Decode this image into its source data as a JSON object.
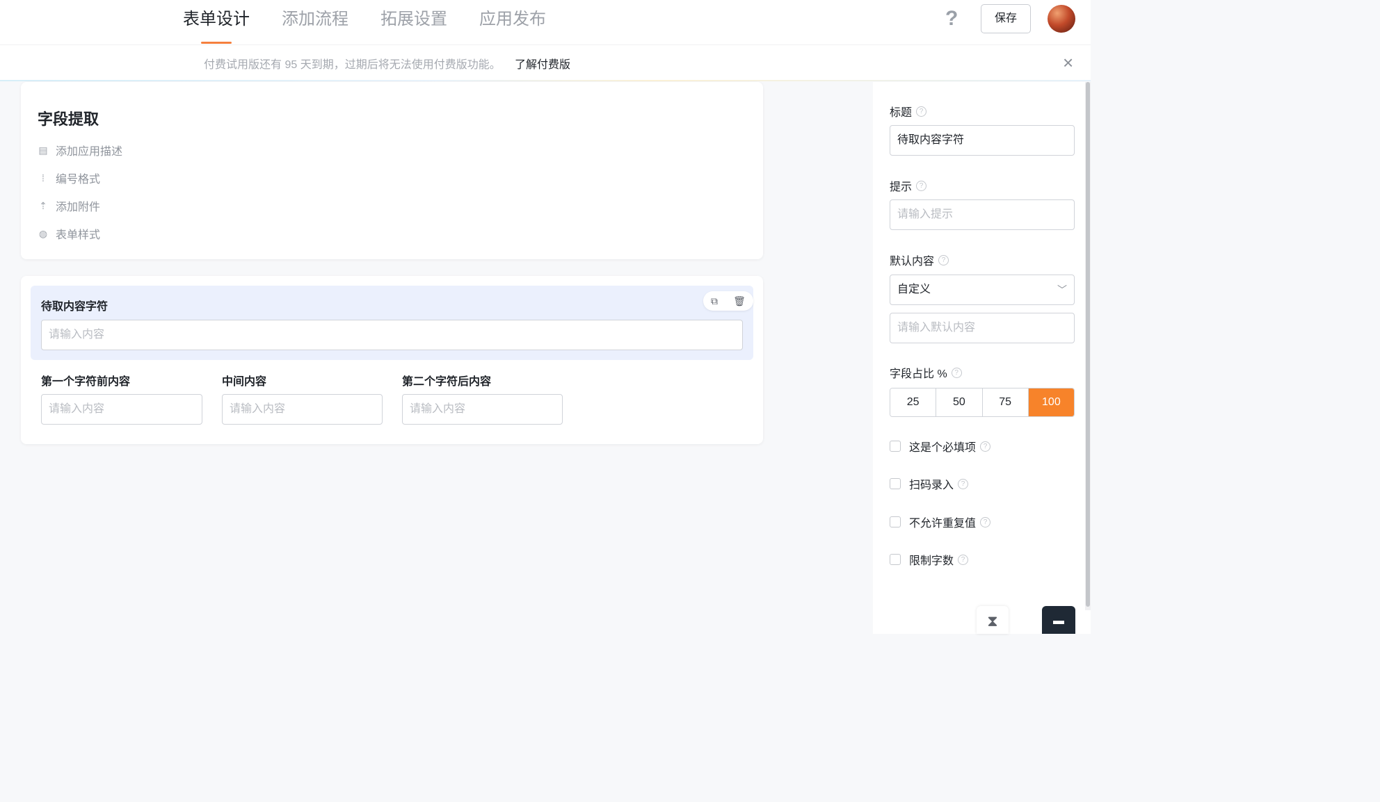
{
  "header": {
    "tabs": [
      {
        "label": "表单设计",
        "active": true
      },
      {
        "label": "添加流程",
        "active": false
      },
      {
        "label": "拓展设置",
        "active": false
      },
      {
        "label": "应用发布",
        "active": false
      }
    ],
    "help_icon": "?",
    "save_label": "保存"
  },
  "notice": {
    "text": "付费试用版还有 95 天到期，过期后将无法使用付费版功能。",
    "link": "了解付费版",
    "close_icon": "×"
  },
  "form_info": {
    "title": "字段提取",
    "actions": [
      {
        "icon": "comment-icon",
        "glyph": "▤",
        "label": "添加应用描述"
      },
      {
        "icon": "number-format-icon",
        "glyph": "⁞",
        "label": "编号格式"
      },
      {
        "icon": "upload-icon",
        "glyph": "⇡",
        "label": "添加附件"
      },
      {
        "icon": "palette-icon",
        "glyph": "◍",
        "label": "表单样式"
      }
    ]
  },
  "field": {
    "selected_label": "待取内容字符",
    "selected_placeholder": "请输入内容",
    "copy_icon": "⧉",
    "delete_icon": "🗑",
    "sub_fields": [
      {
        "label": "第一个字符前内容",
        "placeholder": "请输入内容"
      },
      {
        "label": "中间内容",
        "placeholder": "请输入内容"
      },
      {
        "label": "第二个字符后内容",
        "placeholder": "请输入内容"
      }
    ]
  },
  "panel": {
    "title_label": "标题",
    "title_value": "待取内容字符",
    "hint_label": "提示",
    "hint_placeholder": "请输入提示",
    "default_label": "默认内容",
    "default_select": "自定义",
    "default_placeholder": "请输入默认内容",
    "ratio_label": "字段占比 %",
    "ratio_options": [
      "25",
      "50",
      "75",
      "100"
    ],
    "ratio_selected": "100",
    "checks": [
      {
        "label": "这是个必填项",
        "checked": false
      },
      {
        "label": "扫码录入",
        "checked": false
      },
      {
        "label": "不允许重复值",
        "checked": false
      },
      {
        "label": "限制字数",
        "checked": false
      }
    ],
    "help_glyph": "?"
  },
  "colors": {
    "accent": "#f7832a",
    "tab_underline": "#f5803e",
    "selected_field_bg": "#ebf0fd",
    "chat_button": "#1f2935"
  }
}
